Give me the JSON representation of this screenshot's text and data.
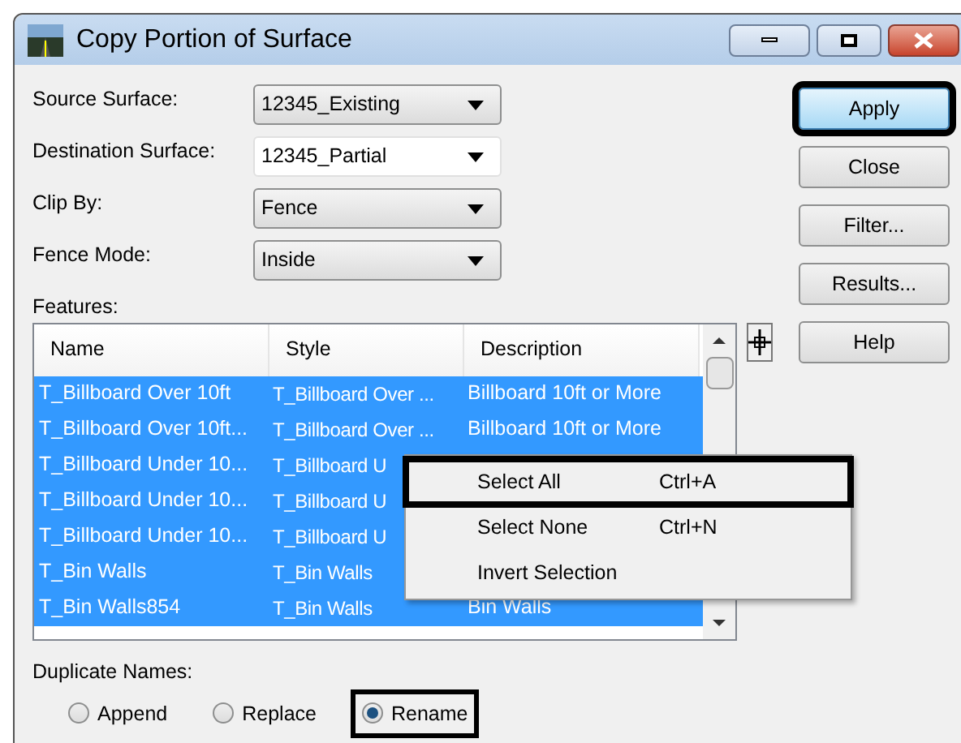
{
  "window": {
    "title": "Copy Portion of Surface"
  },
  "fields": [
    {
      "label": "Source Surface:",
      "value": "12345_Existing",
      "kind": "combo"
    },
    {
      "label": "Destination Surface:",
      "value": "12345_Partial",
      "kind": "editable"
    },
    {
      "label": "Clip By:",
      "value": "Fence",
      "kind": "combo"
    },
    {
      "label": "Fence Mode:",
      "value": "Inside",
      "kind": "combo"
    }
  ],
  "buttons": [
    {
      "label": "Apply",
      "default": true
    },
    {
      "label": "Close",
      "default": false
    },
    {
      "label": "Filter...",
      "default": false
    },
    {
      "label": "Results...",
      "default": false
    },
    {
      "label": "Help",
      "default": false
    }
  ],
  "features": {
    "label": "Features:",
    "columns": [
      "Name",
      "Style",
      "Description"
    ],
    "rows": [
      {
        "name": "T_Billboard Over 10ft",
        "style": "T_Billboard Over ...",
        "description": "Billboard 10ft or More",
        "selected": true
      },
      {
        "name": "T_Billboard Over 10ft...",
        "style": "T_Billboard Over ...",
        "description": "Billboard 10ft or More",
        "selected": true
      },
      {
        "name": "T_Billboard Under 10...",
        "style": "T_Billboard U",
        "selected": true
      },
      {
        "name": "T_Billboard Under 10...",
        "style": "T_Billboard U",
        "selected": true
      },
      {
        "name": "T_Billboard Under 10...",
        "style": "T_Billboard U",
        "selected": true
      },
      {
        "name": "T_Bin Walls",
        "style": "T_Bin Walls",
        "selected": true
      },
      {
        "name": "T_Bin Walls854",
        "style": "T_Bin Walls",
        "description": "Bin Walls",
        "selected": true
      }
    ]
  },
  "context_menu": [
    {
      "label": "Select All",
      "shortcut": "Ctrl+A",
      "highlighted": true
    },
    {
      "label": "Select None",
      "shortcut": "Ctrl+N",
      "highlighted": false
    },
    {
      "label": "Invert Selection",
      "highlighted": false
    }
  ],
  "duplicate_names": {
    "label": "Duplicate Names:",
    "options": [
      {
        "label": "Append",
        "selected": false
      },
      {
        "label": "Replace",
        "selected": false
      },
      {
        "label": "Rename",
        "selected": true
      }
    ]
  }
}
